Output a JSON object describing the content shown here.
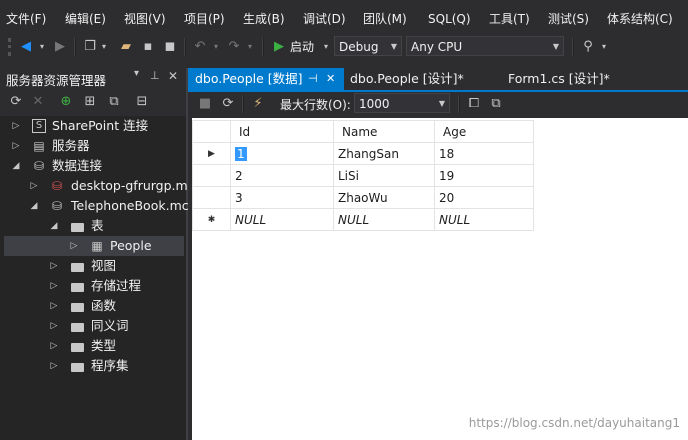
{
  "menu": [
    "文件(F)",
    "编辑(E)",
    "视图(V)",
    "项目(P)",
    "生成(B)",
    "调试(D)",
    "团队(M)",
    "SQL(Q)",
    "工具(T)",
    "测试(S)",
    "体系结构(C)"
  ],
  "toolbar": {
    "start_label": "启动",
    "config_value": "Debug",
    "platform_value": "Any CPU"
  },
  "server_explorer": {
    "title": "服务器资源管理器",
    "tree": [
      {
        "label": "SharePoint 连接",
        "icon": "sharepoint-icon",
        "expander": "collapsed"
      },
      {
        "label": "服务器",
        "icon": "server-icon",
        "expander": "collapsed"
      },
      {
        "label": "数据连接",
        "icon": "data-connections-icon",
        "expander": "expanded"
      },
      {
        "label": "desktop-gfrurgp.m",
        "icon": "database-error-icon",
        "expander": "collapsed"
      },
      {
        "label": "TelephoneBook.mc",
        "icon": "database-icon",
        "expander": "expanded"
      },
      {
        "label": "表",
        "icon": "folder-icon",
        "expander": "expanded"
      },
      {
        "label": "People",
        "icon": "table-icon",
        "expander": "collapsed"
      },
      {
        "label": "视图",
        "icon": "folder-icon",
        "expander": "collapsed"
      },
      {
        "label": "存储过程",
        "icon": "folder-icon",
        "expander": "collapsed"
      },
      {
        "label": "函数",
        "icon": "folder-icon",
        "expander": "collapsed"
      },
      {
        "label": "同义词",
        "icon": "folder-icon",
        "expander": "collapsed"
      },
      {
        "label": "类型",
        "icon": "folder-icon",
        "expander": "collapsed"
      },
      {
        "label": "程序集",
        "icon": "folder-icon",
        "expander": "collapsed"
      }
    ]
  },
  "tabs": [
    {
      "label": "dbo.People [数据]",
      "active": true
    },
    {
      "label": "dbo.People [设计]*",
      "active": false
    },
    {
      "label": "Form1.cs [设计]*",
      "active": false
    }
  ],
  "grid_toolbar": {
    "max_rows_label": "最大行数(O):",
    "max_rows_value": "1000"
  },
  "grid": {
    "columns": [
      "Id",
      "Name",
      "Age"
    ],
    "rows": [
      [
        "1",
        "ZhangSan",
        "18"
      ],
      [
        "2",
        "LiSi",
        "19"
      ],
      [
        "3",
        "ZhaoWu",
        "20"
      ]
    ],
    "new_row": [
      "NULL",
      "NULL",
      "NULL"
    ]
  },
  "watermark": "https://blog.csdn.net/dayuhaitang1",
  "colors": {
    "accent": "#007acc",
    "background": "#2d2d30",
    "tree_bg": "#252526"
  }
}
